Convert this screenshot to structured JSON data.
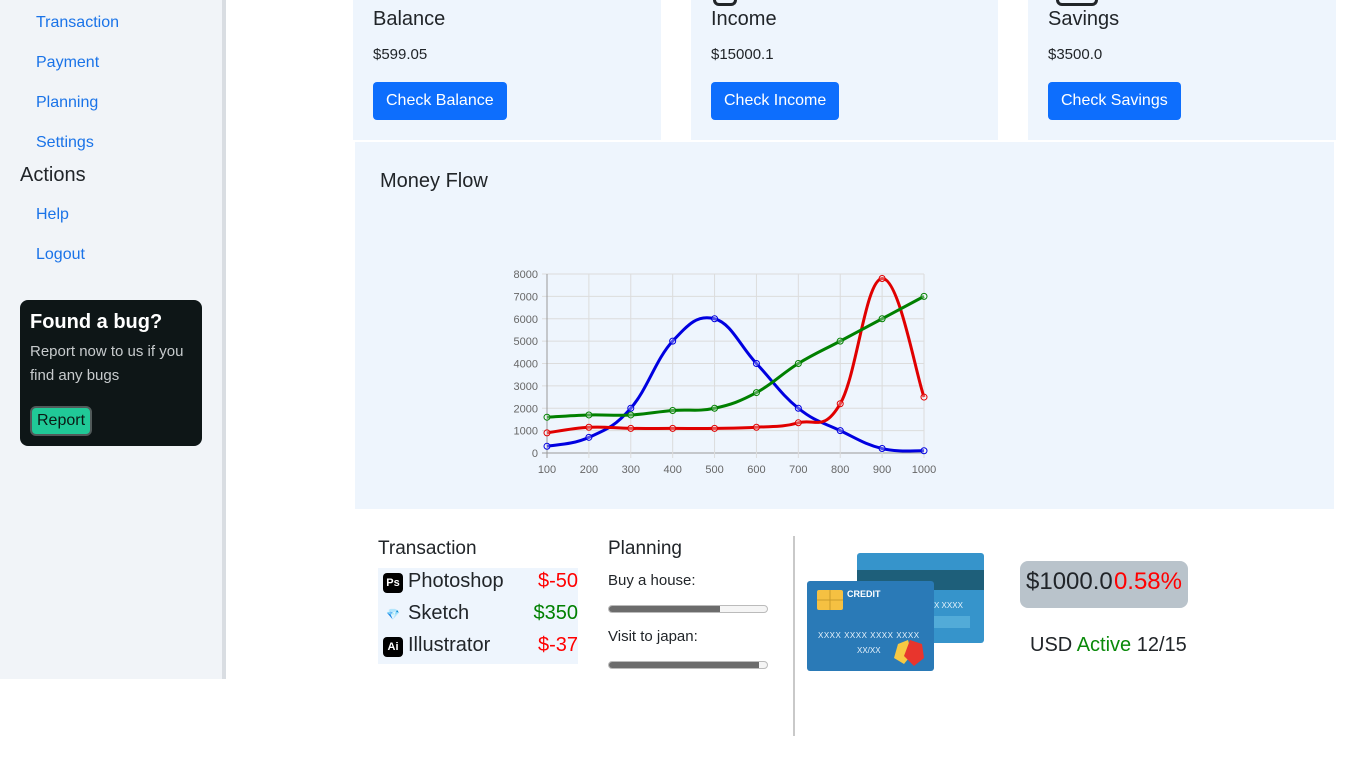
{
  "sidebar": {
    "items": [
      "Transaction",
      "Payment",
      "Planning",
      "Settings"
    ],
    "actions_title": "Actions",
    "actions": [
      "Help",
      "Logout"
    ],
    "bug_card": {
      "title": "Found a bug?",
      "text": "Report now to us if you find any bugs",
      "button": "Report"
    }
  },
  "cards": [
    {
      "title": "Balance",
      "value": "$599.05",
      "button": "Check Balance"
    },
    {
      "title": "Income",
      "value": "$15000.1",
      "button": "Check Income"
    },
    {
      "title": "Savings",
      "value": "$3500.0",
      "button": "Check Savings"
    }
  ],
  "money_flow": {
    "title": "Money Flow"
  },
  "chart_data": {
    "type": "line",
    "title": "",
    "xlabel": "",
    "ylabel": "",
    "x": [
      100,
      200,
      300,
      400,
      500,
      600,
      700,
      800,
      900,
      1000
    ],
    "xticks": [
      "100",
      "200",
      "300",
      "400",
      "500",
      "600",
      "700",
      "800",
      "900",
      "1000"
    ],
    "yticks": [
      "0",
      "1000",
      "2000",
      "3000",
      "4000",
      "5000",
      "6000",
      "7000",
      "8000"
    ],
    "ylim": [
      0,
      8000
    ],
    "grid": true,
    "series": [
      {
        "color": "#0000e0",
        "values": [
          300,
          700,
          2000,
          5000,
          6000,
          4000,
          2000,
          1000,
          200,
          100
        ]
      },
      {
        "color": "#e00000",
        "values": [
          900,
          1150,
          1100,
          1100,
          1100,
          1150,
          1350,
          2200,
          7800,
          2500
        ]
      },
      {
        "color": "#008000",
        "values": [
          1600,
          1700,
          1700,
          1900,
          2000,
          2700,
          4000,
          5000,
          6000,
          7000
        ]
      }
    ]
  },
  "transactions": {
    "title": "Transaction",
    "items": [
      {
        "icon": "Ps",
        "name": "Photoshop",
        "amount": "$-50",
        "color": "#ff0000"
      },
      {
        "icon": "💎",
        "name": "Sketch",
        "amount": "$350",
        "color": "#008000"
      },
      {
        "icon": "Ai",
        "name": "Illustrator",
        "amount": "$-37",
        "color": "#ff0000"
      }
    ]
  },
  "planning": {
    "title": "Planning",
    "goals": [
      {
        "label": "Buy a house:",
        "progress": 0.7
      },
      {
        "label": "Visit to japan:",
        "progress": 0.95
      }
    ]
  },
  "credit_card": {
    "label": "CREDIT",
    "number": "XXXX XXXX XXXX XXXX",
    "expiry": "XX/XX",
    "back_number": "X XXXX",
    "amount": "$1000.0",
    "change": "0.58%",
    "currency": "USD",
    "status": "Active",
    "date": "12/15",
    "colors": {
      "front": "#2a7ab7",
      "back": "#3694cb",
      "stripe": "#1e5f7a",
      "chip": "#f5c142",
      "logo_red": "#e8352d",
      "logo_yellow": "#f7c843"
    }
  }
}
